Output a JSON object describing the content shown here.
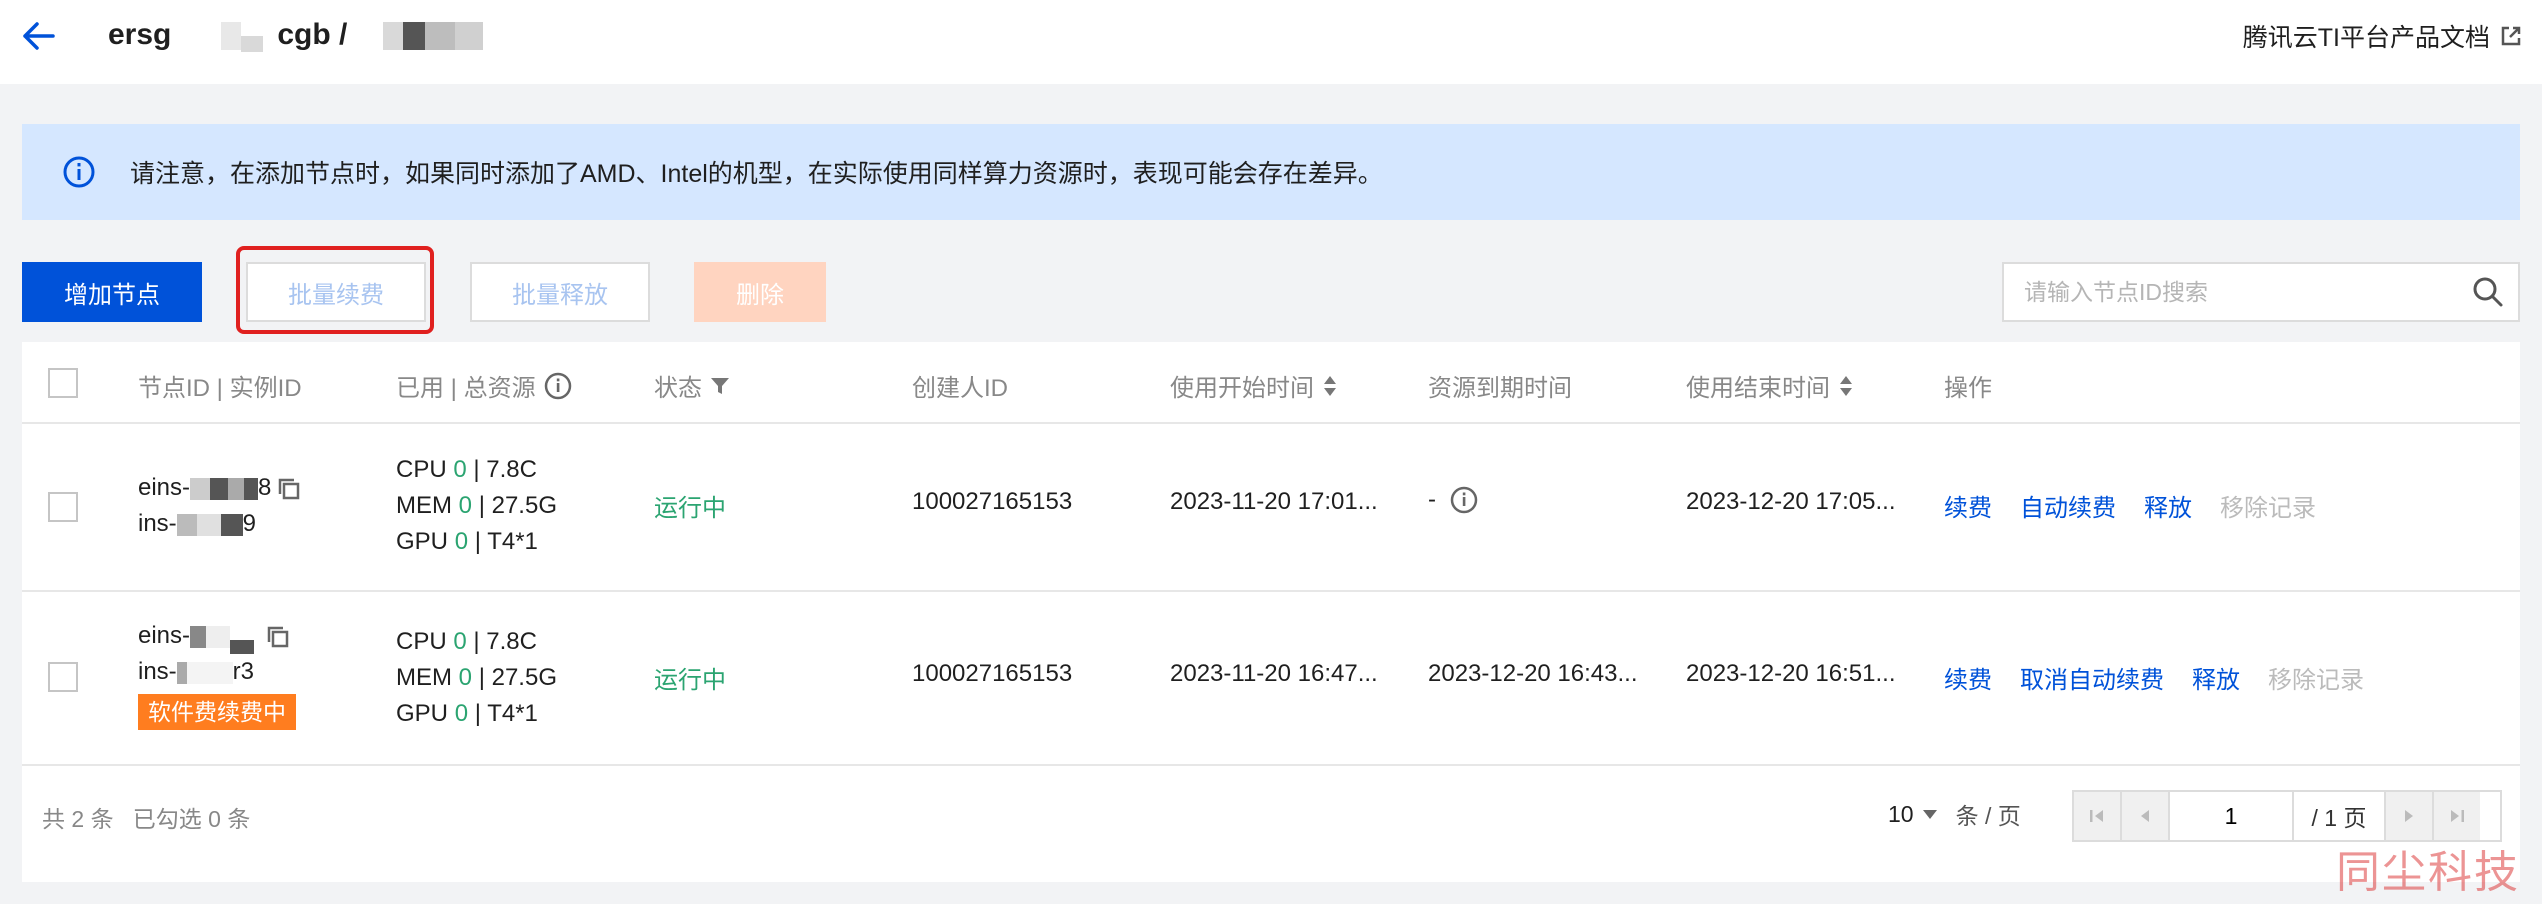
{
  "header": {
    "title_start": "ersg",
    "title_mid": "cgb /",
    "doc_link": "腾讯云TI平台产品文档"
  },
  "notice": {
    "text": "请注意，在添加节点时，如果同时添加了AMD、Intel的机型，在实际使用同样算力资源时，表现可能会存在差异。"
  },
  "toolbar": {
    "add_node": "增加节点",
    "batch_renew": "批量续费",
    "batch_release": "批量释放",
    "delete": "删除",
    "search_placeholder": "请输入节点ID搜索"
  },
  "table": {
    "columns": {
      "node_id": "节点ID | 实例ID",
      "resources": "已用 | 总资源",
      "status": "状态",
      "creator": "创建人ID",
      "start_time": "使用开始时间",
      "expire_time": "资源到期时间",
      "end_time": "使用结束时间",
      "actions": "操作"
    },
    "rows": [
      {
        "node_id": "eins-",
        "node_id_end": "8",
        "instance_id": "ins-",
        "instance_id_end": "9",
        "cpu_label": "CPU",
        "cpu_used": "0",
        "cpu_total": "| 7.8C",
        "mem_label": "MEM",
        "mem_used": "0",
        "mem_total": "| 27.5G",
        "gpu_label": "GPU",
        "gpu_used": "0",
        "gpu_total": "| T4*1",
        "status": "运行中",
        "creator": "100027165153",
        "start_time": "2023-11-20 17:01...",
        "expire_time": "-",
        "end_time": "2023-12-20 17:05...",
        "actions": [
          "续费",
          "自动续费",
          "释放"
        ],
        "disabled_action": "移除记录"
      },
      {
        "node_id": "eins-",
        "node_id_end": "",
        "instance_id": "ins-",
        "instance_id_end": "r3",
        "tag": "软件费续费中",
        "cpu_label": "CPU",
        "cpu_used": "0",
        "cpu_total": "| 7.8C",
        "mem_label": "MEM",
        "mem_used": "0",
        "mem_total": "| 27.5G",
        "gpu_label": "GPU",
        "gpu_used": "0",
        "gpu_total": "| T4*1",
        "status": "运行中",
        "creator": "100027165153",
        "start_time": "2023-11-20 16:47...",
        "expire_time": "2023-12-20 16:43...",
        "end_time": "2023-12-20 16:51...",
        "actions": [
          "续费",
          "取消自动续费",
          "释放"
        ],
        "disabled_action": "移除记录"
      }
    ]
  },
  "footer": {
    "summary": "共 2 条   已勾选 0 条",
    "page_size": "10",
    "page_size_suffix": "条 / 页",
    "current_page": "1",
    "total_pages": "/ 1 页"
  },
  "watermark": "同尘科技",
  "colors": {
    "primary": "#0052d9",
    "success": "#2ba471",
    "notice_bg": "#d5e7ff",
    "highlight": "#e0201f",
    "tag": "#ff7d1f"
  }
}
